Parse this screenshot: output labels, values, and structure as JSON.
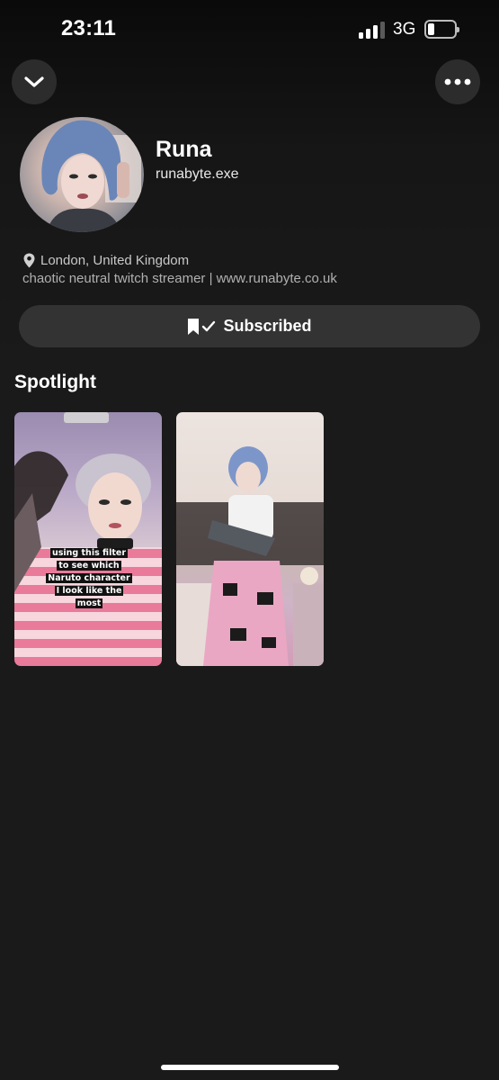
{
  "status_bar": {
    "time": "23:11",
    "network": "3G",
    "signal_bars_active": 3,
    "signal_bars_total": 4,
    "battery_level": 0.2
  },
  "header": {
    "back_icon": "chevron-down-icon",
    "more_icon": "more-horizontal-icon"
  },
  "profile": {
    "name": "Runa",
    "username": "runabyte.exe",
    "location_icon": "location-pin-icon",
    "location": "London, United Kingdom",
    "bio": "chaotic neutral twitch streamer | www.runabyte.co.uk"
  },
  "subscribe_button": {
    "icon": "bookmark-check-icon",
    "label": "Subscribed"
  },
  "spotlight": {
    "title": "Spotlight",
    "items": [
      {
        "caption": "using this filter to see which Naruto character I look like the most"
      },
      {
        "caption": ""
      }
    ]
  },
  "colors": {
    "background": "#1a1a1a",
    "button": "#333333",
    "text_primary": "#ffffff",
    "text_secondary": "#b0b0b0"
  }
}
